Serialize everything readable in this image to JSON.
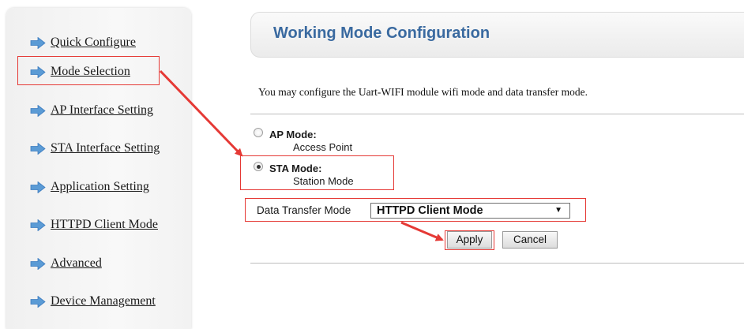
{
  "sidebar": {
    "items": [
      {
        "label": "Quick Configure"
      },
      {
        "label": "Mode Selection"
      },
      {
        "label": "AP Interface Setting"
      },
      {
        "label": "STA Interface Setting"
      },
      {
        "label": "Application Setting"
      },
      {
        "label": "HTTPD Client Mode"
      },
      {
        "label": "Advanced"
      },
      {
        "label": "Device Management"
      }
    ]
  },
  "main": {
    "title": "Working Mode Configuration",
    "description": "You may configure the Uart-WIFI module wifi mode and data transfer mode.",
    "modes": [
      {
        "title": "AP Mode:",
        "subtitle": "Access Point",
        "checked": false
      },
      {
        "title": "STA Mode:",
        "subtitle": "Station Mode",
        "checked": true
      }
    ],
    "data_transfer": {
      "label": "Data Transfer Mode",
      "selected": "HTTPD Client Mode"
    },
    "buttons": {
      "apply": "Apply",
      "cancel": "Cancel"
    }
  },
  "colors": {
    "title": "#3a6aa0",
    "nav_arrow": "#5b9bd5",
    "annotation": "#e53935"
  },
  "icons": {
    "nav_arrow": "right-arrow-icon",
    "select_caret": "triangle-down-icon"
  }
}
